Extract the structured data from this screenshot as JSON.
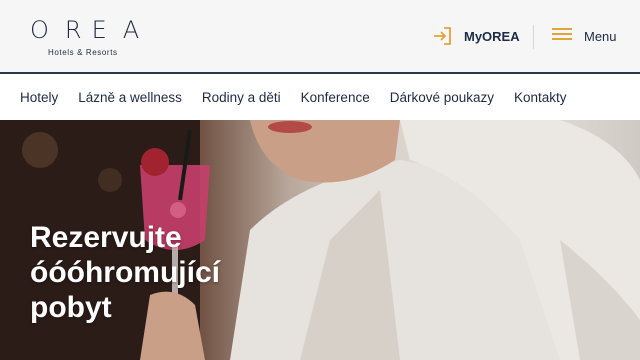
{
  "brand": {
    "wordmark": "OREA",
    "tagline": "Hotels & Resorts"
  },
  "header": {
    "myorea_label": "MyOREA",
    "myorea_icon": "login-icon",
    "menu_label": "Menu",
    "menu_icon": "hamburger-icon",
    "accent_color": "#e0a43a",
    "text_color": "#1f2b44"
  },
  "nav": {
    "items": [
      {
        "label": "Hotely"
      },
      {
        "label": "Lázně a wellness"
      },
      {
        "label": "Rodiny a děti"
      },
      {
        "label": "Konference"
      },
      {
        "label": "Dárkové poukazy"
      },
      {
        "label": "Kontakty"
      }
    ]
  },
  "hero": {
    "title_lines": [
      "Rezervujte",
      "óóóhromující",
      "pobyt"
    ]
  }
}
